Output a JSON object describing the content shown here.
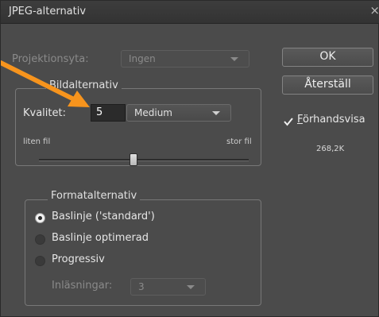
{
  "window": {
    "title": "JPEG-alternativ",
    "close": "×"
  },
  "projection": {
    "label": "Projektionsyta:",
    "value": "Ingen"
  },
  "image_options": {
    "legend": "Bildalternativ",
    "quality_label": "Kvalitet:",
    "quality_value": "5",
    "quality_preset": "Medium",
    "small_file_label": "liten fil",
    "large_file_label": "stor fil",
    "slider_value_percent": 45
  },
  "format_options": {
    "legend": "Formatalternativ",
    "options": [
      {
        "label": "Baslinje ('standard')",
        "checked": true
      },
      {
        "label": "Baslinje optimerad",
        "checked": false
      },
      {
        "label": "Progressiv",
        "checked": false
      }
    ],
    "scans_label": "Inläsningar:",
    "scans_value": "3"
  },
  "buttons": {
    "ok": "OK",
    "reset": "Återställ"
  },
  "preview": {
    "label_first": "F",
    "label_rest": "örhandsvisa",
    "checked": true
  },
  "file_size": "268,2K",
  "colors": {
    "annotation_arrow": "#f7941d",
    "dialog_bg": "#4b4b4b"
  }
}
